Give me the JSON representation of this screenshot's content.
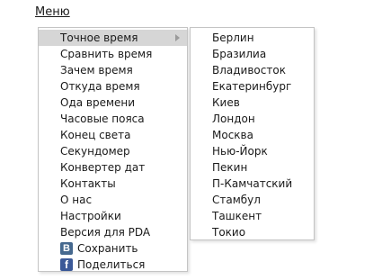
{
  "menu": {
    "title": "Меню",
    "items": [
      {
        "label": "Точное время",
        "active": true
      },
      {
        "label": "Сравнить время"
      },
      {
        "label": "Зачем время"
      },
      {
        "label": "Откуда время"
      },
      {
        "label": "Ода времени"
      },
      {
        "label": "Часовые пояса"
      },
      {
        "label": "Конец света"
      },
      {
        "label": "Секундомер"
      },
      {
        "label": "Конвертер дат"
      },
      {
        "label": "Контакты"
      },
      {
        "label": "О нас"
      },
      {
        "label": "Настройки"
      },
      {
        "label": "Версия для PDA"
      }
    ],
    "share": [
      {
        "icon": "vk-icon",
        "icon_letter": "B",
        "label": "Сохранить"
      },
      {
        "icon": "facebook-icon",
        "icon_letter": "f",
        "label": "Поделиться"
      }
    ]
  },
  "submenu": {
    "cities": [
      "Берлин",
      "Бразилиа",
      "Владивосток",
      "Екатеринбург",
      "Киев",
      "Лондон",
      "Москва",
      "Нью-Йорк",
      "Пекин",
      "П-Камчатский",
      "Стамбул",
      "Ташкент",
      "Токио"
    ]
  },
  "colors": {
    "active_bg": "#d6d6d6",
    "border": "#c4c4c4",
    "vk": "#45688e",
    "facebook": "#3b5998"
  }
}
